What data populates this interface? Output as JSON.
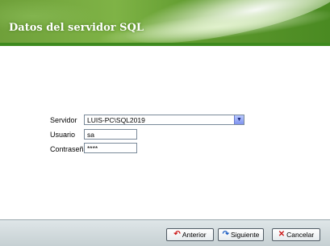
{
  "header": {
    "title": "Datos del servidor SQL"
  },
  "form": {
    "servidor": {
      "label": "Servidor",
      "value": "LUIS-PC\\SQL2019"
    },
    "usuario": {
      "label": "Usuario",
      "value": "sa"
    },
    "contrasena": {
      "label": "Contraseña",
      "value": "****"
    }
  },
  "footer": {
    "anterior": {
      "label": "Anterior",
      "icon": "undo-arrow-icon"
    },
    "siguiente": {
      "label": "Siguiente",
      "icon": "redo-arrow-icon"
    },
    "cancelar": {
      "label": "Cancelar",
      "icon": "x-icon"
    }
  },
  "colors": {
    "accent": "#5f9a2e",
    "footer": "#d3dcdf"
  }
}
